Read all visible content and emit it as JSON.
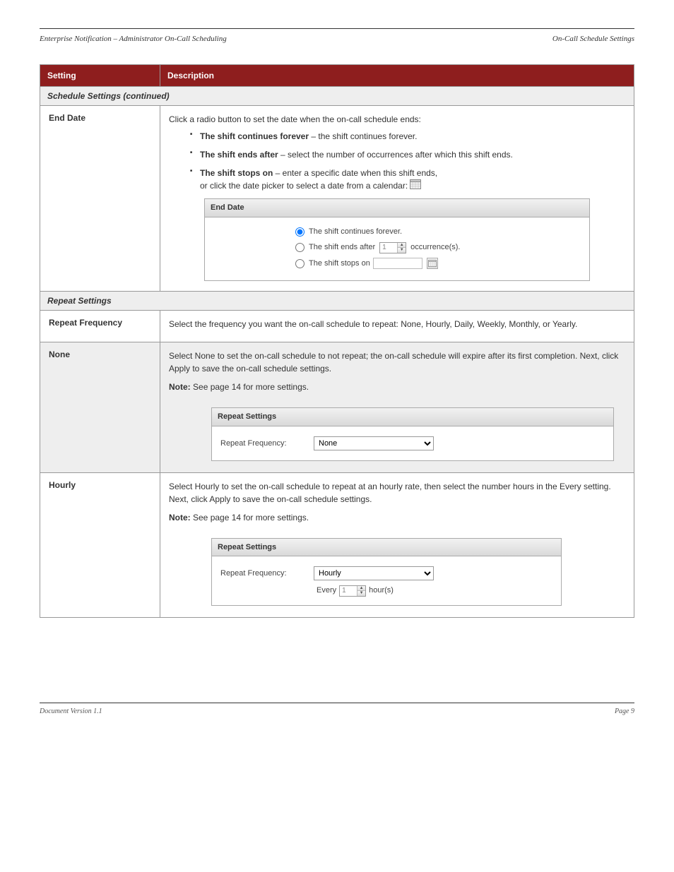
{
  "doc": {
    "header_left": "Enterprise Notification – Administrator On-Call Scheduling",
    "header_right": "On-Call Schedule Settings",
    "footer_left": "Document Version 1.1",
    "footer_right": "Page 9"
  },
  "table": {
    "col_setting": "Setting",
    "col_desc": "Description",
    "section_continued": "Schedule Settings (continued)",
    "section_repeat": "Repeat Settings",
    "end_date_label": "End Date",
    "end_date_intro": "Click a radio button to set the date when the on-call schedule ends:",
    "bullet1_pre": "The shift continues forever",
    "bullet1_post": " – the shift continues forever.",
    "bullet2_pre": "The shift ends after",
    "bullet2_post": " – select the number of occurrences after which this shift ends.",
    "bullet3_pre": "The shift stops on",
    "bullet3_post": " – enter a specific date when this shift ends,",
    "bullet3_cont": "or click the date picker to select a date from a calendar: ",
    "panel_end_date_title": "End Date",
    "radio_forever": "The shift continues forever.",
    "radio_after_pre": "The shift ends after",
    "radio_after_input": "1",
    "radio_after_post": "occurrence(s).",
    "radio_stops": "The shift stops on",
    "repeat_freq_label": "Repeat Frequency",
    "repeat_freq_desc": "Select the frequency you want the on-call schedule to repeat: None, Hourly, Daily, Weekly, Monthly, or Yearly.",
    "none_label": "None",
    "none_desc_1": "Select None to set the on-call schedule to not repeat; the on-call schedule will expire after its first completion. Next, click Apply to save the on-call schedule settings.",
    "none_note": "Note: See page 14 for more settings.",
    "rs_title": "Repeat Settings",
    "rs_label": "Repeat Frequency:",
    "rs_none": "None",
    "hourly_label": "Hourly",
    "hourly_desc": "Select Hourly to set the on-call schedule to repeat at an hourly rate, then select the number hours in the Every setting. Next, click Apply to save the on-call schedule settings.",
    "hourly_note": "Note: See page 14 for more settings.",
    "rs_hourly": "Hourly",
    "every": "Every",
    "every_val": "1",
    "hours": "hour(s)"
  }
}
